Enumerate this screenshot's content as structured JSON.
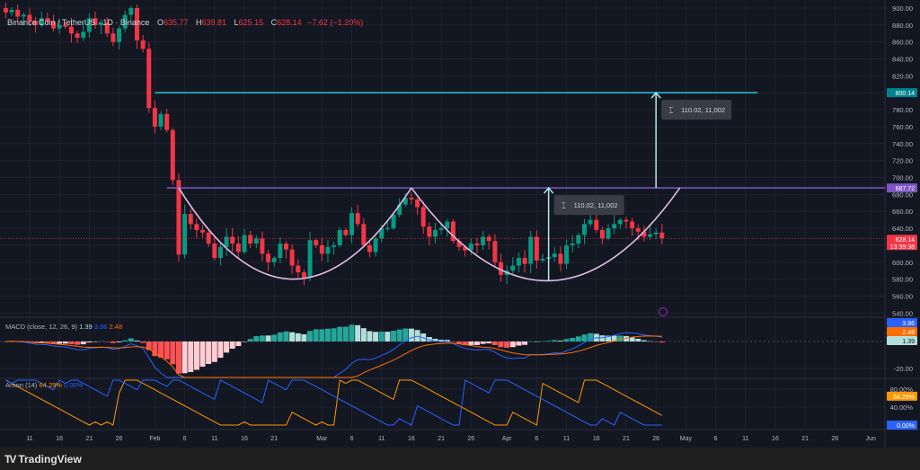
{
  "header": {
    "symbol": "Binance Coin / TetherUS · 1D · Binance",
    "open_label": "O",
    "open": "635.77",
    "high_label": "H",
    "high": "639.81",
    "low_label": "L",
    "low": "625.15",
    "close_label": "C",
    "close": "628.14",
    "change": "−7.62 (−1.20%)"
  },
  "macd_legend": {
    "name": "MACD (close, 12, 26, 9)",
    "hist": "1.39",
    "macd": "3.86",
    "signal": "2.48"
  },
  "aroon_legend": {
    "name": "Aroon (14)",
    "up": "64.29%",
    "down": "0.00%"
  },
  "footer": {
    "brand": "TradingView"
  },
  "colors": {
    "up": "#089981",
    "down": "#f23645",
    "bg": "#131722",
    "resistance": "#26c6da",
    "neckline": "#7e57c2",
    "cup": "#e1bee7",
    "macd": "#2962ff",
    "signal": "#ff6d00"
  },
  "chart_data": {
    "type": "candlestick",
    "title": "Binance Coin / TetherUS · 1D · Binance",
    "ylim": [
      530,
      905
    ],
    "yticks": [
      "900.00",
      "880.00",
      "860.00",
      "840.00",
      "820.00",
      "800.00",
      "780.00",
      "760.00",
      "740.00",
      "720.00",
      "700.00",
      "680.00",
      "660.00",
      "640.00",
      "620.00",
      "600.00",
      "580.00",
      "560.00",
      "540.00"
    ],
    "ytick_values": [
      900,
      880,
      860,
      840,
      820,
      800,
      780,
      760,
      740,
      720,
      700,
      680,
      660,
      640,
      620,
      600,
      580,
      560,
      540
    ],
    "xticks": [
      {
        "label": "11",
        "day": 4
      },
      {
        "label": "16",
        "day": 9
      },
      {
        "label": "21",
        "day": 14
      },
      {
        "label": "26",
        "day": 19
      },
      {
        "label": "Feb",
        "day": 25
      },
      {
        "label": "6",
        "day": 30
      },
      {
        "label": "11",
        "day": 35
      },
      {
        "label": "16",
        "day": 40
      },
      {
        "label": "21",
        "day": 45
      },
      {
        "label": "Mar",
        "day": 53
      },
      {
        "label": "6",
        "day": 58
      },
      {
        "label": "11",
        "day": 63
      },
      {
        "label": "16",
        "day": 68
      },
      {
        "label": "21",
        "day": 73
      },
      {
        "label": "26",
        "day": 78
      },
      {
        "label": "Apr",
        "day": 84
      },
      {
        "label": "6",
        "day": 89
      },
      {
        "label": "11",
        "day": 94
      },
      {
        "label": "16",
        "day": 99
      },
      {
        "label": "21",
        "day": 104
      },
      {
        "label": "26",
        "day": 109
      },
      {
        "label": "May",
        "day": 114
      },
      {
        "label": "6",
        "day": 119
      },
      {
        "label": "11",
        "day": 124
      },
      {
        "label": "16",
        "day": 129
      },
      {
        "label": "21",
        "day": 134
      },
      {
        "label": "26",
        "day": 139
      },
      {
        "label": "Jun",
        "day": 145
      }
    ],
    "first_day": "Jan 7",
    "closes": [
      895,
      898,
      890,
      892,
      885,
      880,
      888,
      884,
      876,
      880,
      878,
      870,
      865,
      872,
      888,
      880,
      883,
      870,
      860,
      876,
      892,
      900,
      862,
      852,
      782,
      760,
      775,
      756,
      697,
      609,
      657,
      645,
      638,
      635,
      622,
      605,
      618,
      630,
      622,
      612,
      632,
      622,
      628,
      610,
      600,
      605,
      622,
      615,
      596,
      588,
      582,
      626,
      620,
      610,
      618,
      620,
      638,
      632,
      658,
      645,
      620,
      612,
      628,
      640,
      640,
      656,
      668,
      676,
      674,
      665,
      642,
      630,
      638,
      640,
      648,
      625,
      618,
      614,
      622,
      620,
      630,
      625,
      600,
      585,
      590,
      596,
      605,
      598,
      630,
      602,
      604,
      606,
      610,
      598,
      620,
      622,
      632,
      645,
      650,
      638,
      628,
      640,
      645,
      650,
      648,
      640,
      636,
      630,
      633,
      635,
      628.14
    ],
    "first_open": 900,
    "price_line": {
      "value": 628.14,
      "label": "628.14",
      "countdown": "13:39:38"
    },
    "levels": [
      {
        "name": "target",
        "value": 800.14,
        "label": "800.14",
        "from_day": 25,
        "to_day": 126
      },
      {
        "name": "neckline",
        "value": 687.72,
        "label": "687.72",
        "from_day": 27,
        "to_day": 160
      }
    ],
    "cups": [
      {
        "start_day": 29,
        "bottom_day": 48,
        "end_day": 68,
        "rim": 687.72,
        "bottom": 580
      },
      {
        "start_day": 68,
        "bottom_day": 91,
        "end_day": 113,
        "rim": 687.72,
        "bottom": 578
      }
    ],
    "measures": [
      {
        "day": 91,
        "from": 578,
        "to": 687.72,
        "label": "110.02, 11,002"
      },
      {
        "day": 109,
        "from": 687.72,
        "to": 800.14,
        "label": "110.02, 11,002"
      }
    ],
    "macd": {
      "fast": 12,
      "slow": 26,
      "signal": 9,
      "axis_labels": [
        "3.86",
        "2.48",
        "1.39"
      ],
      "grid_label": "-20.00",
      "grid_value": -20
    },
    "aroon": {
      "period": 14,
      "axis_labels": [
        "80.00%",
        "40.00%"
      ],
      "axis_values": [
        80,
        40
      ],
      "up_label": "64.29%",
      "down_label": "0.00%"
    }
  }
}
